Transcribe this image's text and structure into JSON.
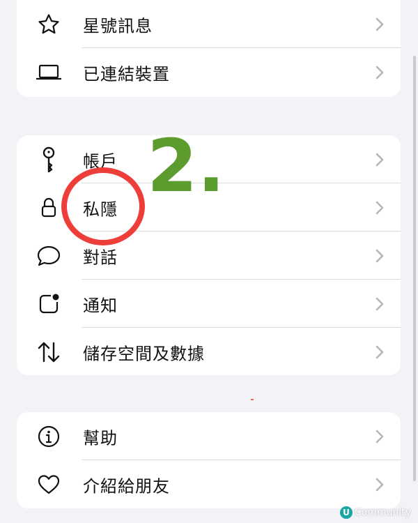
{
  "group1": {
    "items": [
      {
        "label": "星號訊息",
        "icon": "star-icon"
      },
      {
        "label": "已連結裝置",
        "icon": "laptop-icon"
      }
    ]
  },
  "group2": {
    "items": [
      {
        "label": "帳戶",
        "icon": "key-icon"
      },
      {
        "label": "私隱",
        "icon": "lock-icon"
      },
      {
        "label": "對話",
        "icon": "chat-bubble-icon"
      },
      {
        "label": "通知",
        "icon": "notification-icon"
      },
      {
        "label": "儲存空間及數據",
        "icon": "up-down-arrows-icon"
      }
    ]
  },
  "group3": {
    "items": [
      {
        "label": "幫助",
        "icon": "info-icon"
      },
      {
        "label": "介紹給朋友",
        "icon": "heart-icon"
      }
    ]
  },
  "annotation": {
    "number": "2.",
    "circle_color": "#ee3e3a",
    "number_color": "#5c9c2e"
  },
  "watermark": {
    "badge": "U",
    "text": "Community"
  }
}
